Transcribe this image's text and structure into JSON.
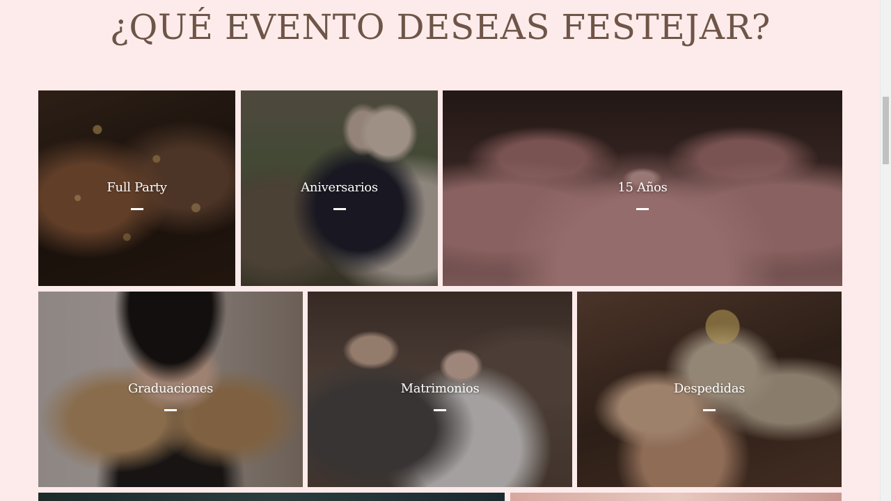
{
  "heading": "¿QUÉ EVENTO DESEAS FESTEJAR?",
  "events": [
    {
      "label": "Full Party"
    },
    {
      "label": "Aniversarios"
    },
    {
      "label": "15 Años"
    },
    {
      "label": "Graduaciones"
    },
    {
      "label": "Matrimonios"
    },
    {
      "label": "Despedidas"
    }
  ],
  "colors": {
    "background": "#fcebea",
    "heading": "#6e5548",
    "label": "#ffffff"
  }
}
